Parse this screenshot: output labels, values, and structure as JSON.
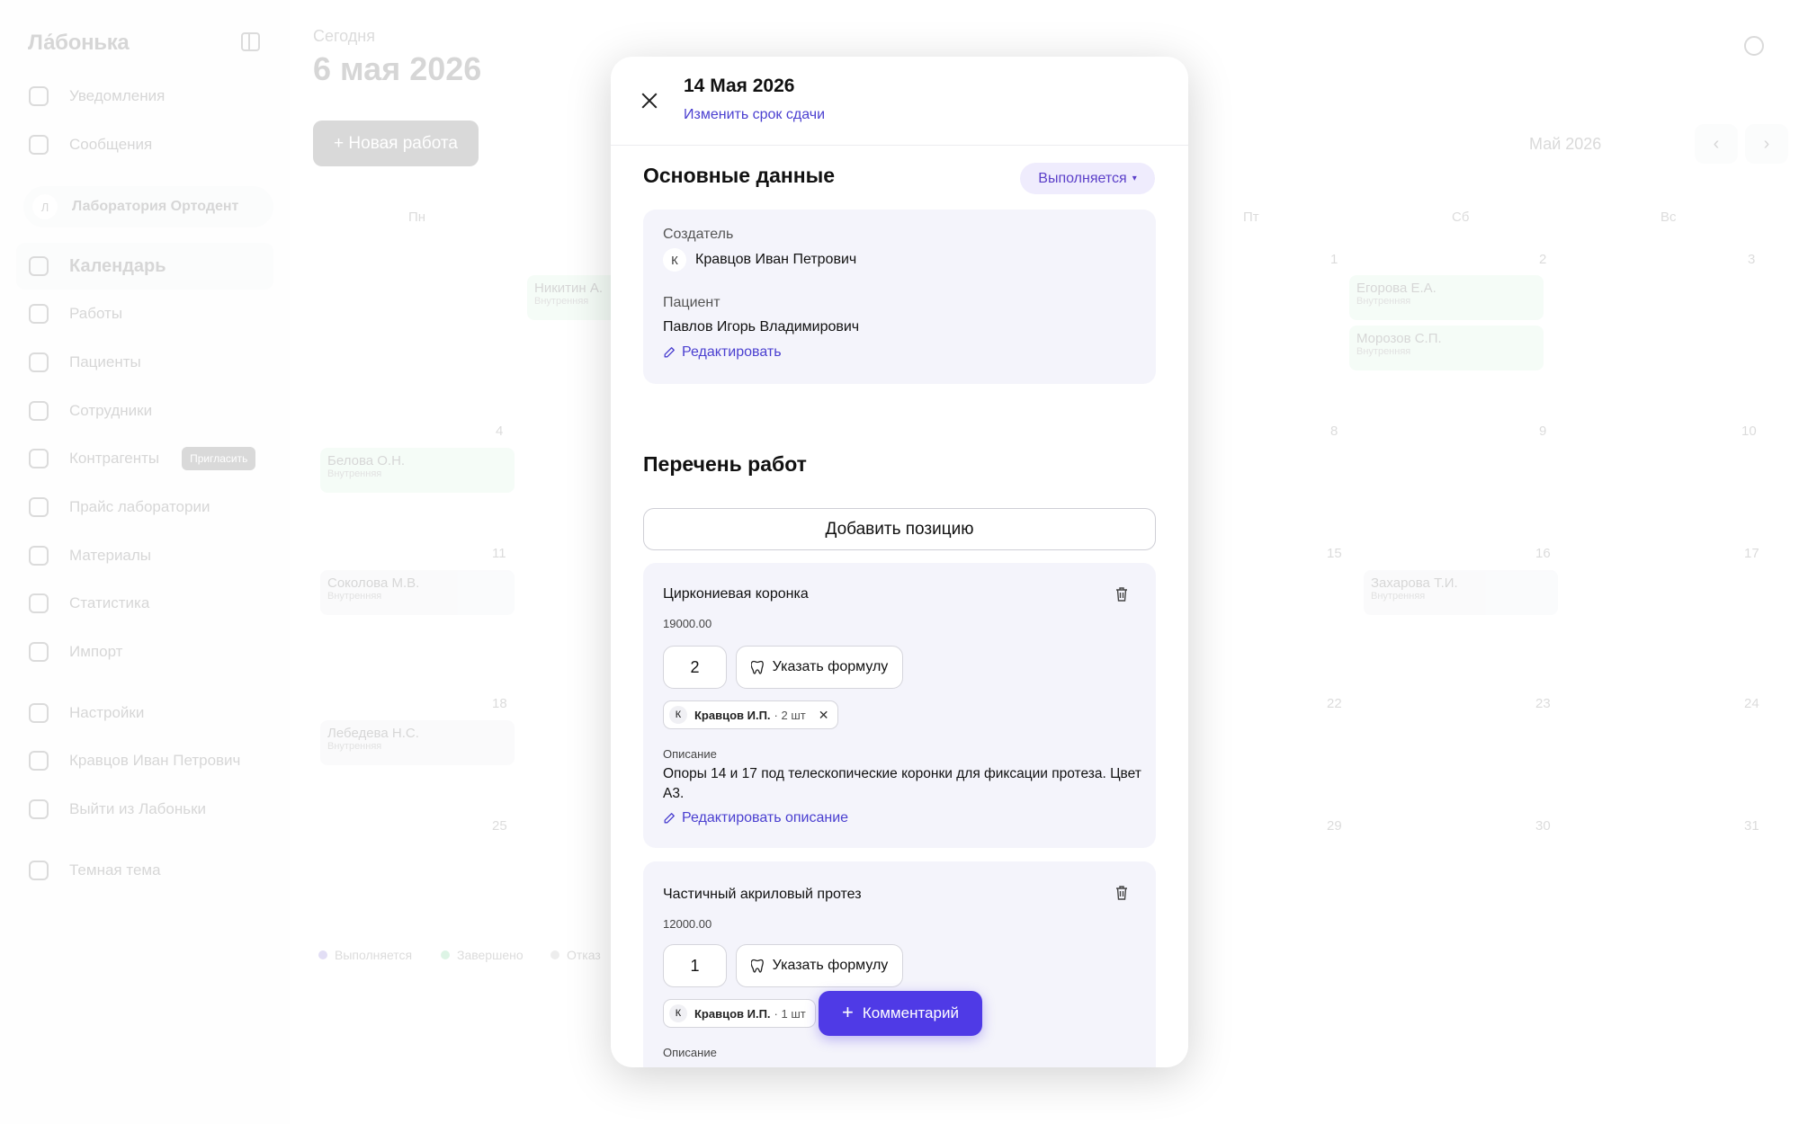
{
  "app": {
    "logo": "Ла́бонька"
  },
  "sidebar": {
    "items": [
      {
        "label": "Уведомления",
        "icon": "bell-icon"
      },
      {
        "label": "Сообщения",
        "icon": "chat-icon"
      },
      {
        "label": "Календарь",
        "icon": "calendar-icon"
      },
      {
        "label": "Работы",
        "icon": "works-icon"
      },
      {
        "label": "Пациенты",
        "icon": "patients-icon"
      },
      {
        "label": "Сотрудники",
        "icon": "staff-icon"
      },
      {
        "label": "Контрагенты",
        "icon": "partners-icon"
      },
      {
        "label": "Прайс лаборатории",
        "icon": "price-icon"
      },
      {
        "label": "Материалы",
        "icon": "materials-icon"
      },
      {
        "label": "Статистика",
        "icon": "stats-icon"
      },
      {
        "label": "Импорт",
        "icon": "import-icon"
      },
      {
        "label": "Настройки",
        "icon": "settings-icon"
      },
      {
        "label": "Кравцов Иван Петрович",
        "icon": "user-avatar"
      },
      {
        "label": "Выйти из Лабоньки",
        "icon": "logout-icon"
      },
      {
        "label": "Темная тема",
        "icon": "moon-icon"
      }
    ],
    "org": {
      "initial": "Л",
      "name": "Лаборатория Ортодент"
    },
    "invite_label": "Пригласить"
  },
  "main": {
    "today_label": "Сегодня",
    "date": "6 мая 2026",
    "new_work_label": "+ Новая работа",
    "month_selector": "Май 2026",
    "weekdays": [
      "Пн",
      "Пт",
      "Сб",
      "Вс"
    ],
    "days": [
      "1",
      "2",
      "3",
      "4",
      "8",
      "9",
      "10",
      "11",
      "15",
      "16",
      "17",
      "18",
      "22",
      "23",
      "24",
      "25",
      "29",
      "30",
      "31"
    ],
    "events": [
      {
        "name": "Никитин А.",
        "type": "Внутренняя"
      },
      {
        "name": "Егорова Е.А.",
        "type": "Внутренняя"
      },
      {
        "name": "Морозов С.П.",
        "type": "Внутренняя"
      },
      {
        "name": "Белова О.Н.",
        "type": "Внутренняя"
      },
      {
        "name": "Соколова М.В.",
        "type": "Внутренняя"
      },
      {
        "name": "Захарова Т.И.",
        "type": "Внутренняя"
      },
      {
        "name": "Лебедева Н.С.",
        "type": "Внутренняя"
      }
    ],
    "legend": [
      "Выполняется",
      "Завершено",
      "Отказ"
    ]
  },
  "modal": {
    "date": "14 Мая 2026",
    "change_deadline": "Изменить срок сдачи",
    "basic_title": "Основные данные",
    "status": "Выполняется",
    "creator_label": "Создатель",
    "creator_initial": "К",
    "creator_name": "Кравцов Иван Петрович",
    "patient_label": "Пациент",
    "patient_name": "Павлов Игорь Владимирович",
    "edit_label": "Редактировать",
    "works_title": "Перечень работ",
    "add_position": "Добавить позицию",
    "items": [
      {
        "name": "Циркониевая коронка",
        "price": "19000.00",
        "qty": "2",
        "formula_label": "Указать формулу",
        "chip_initial": "К",
        "chip_name": "Кравцов И.П.",
        "chip_qty": "· 2 шт",
        "desc_label": "Описание",
        "desc": "Опоры 14 и 17 под телескопические коронки для фиксации протеза. Цвет А3.",
        "edit_desc": "Редактировать описание"
      },
      {
        "name": "Частичный акриловый протез",
        "price": "12000.00",
        "qty": "1",
        "formula_label": "Указать формулу",
        "chip_initial": "К",
        "chip_name": "Кравцов И.П.",
        "chip_qty": "· 1 шт",
        "desc_label": "Описание"
      }
    ],
    "comment_label": "Комментарий",
    "colors": {
      "accent": "#4f3ae6",
      "link": "#4a3fd0",
      "status_bg": "#efecfd"
    }
  }
}
